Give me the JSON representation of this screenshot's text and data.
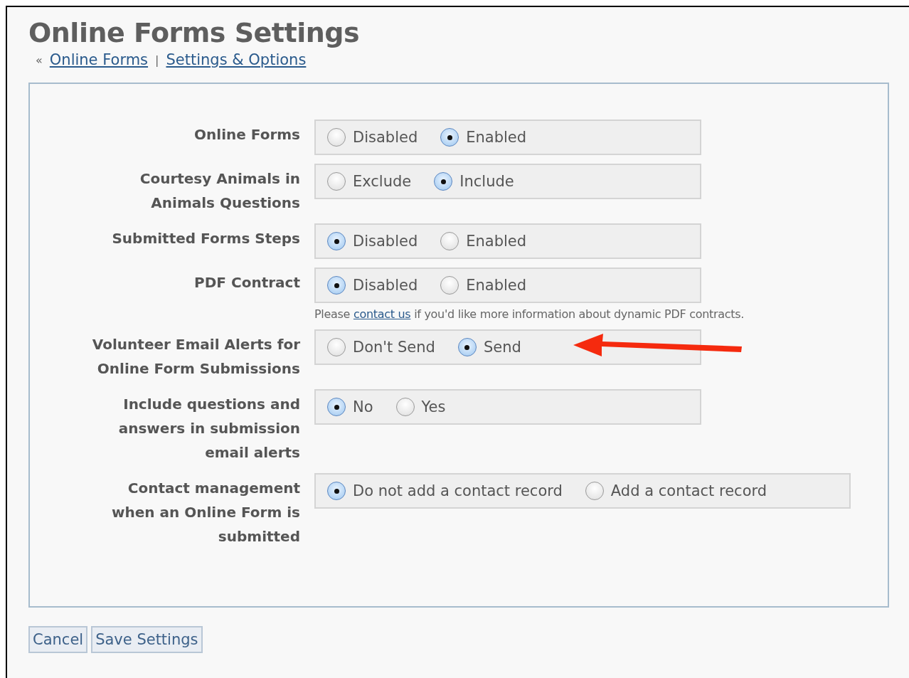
{
  "title": "Online Forms Settings",
  "breadcrumb": {
    "separator_prefix": "«",
    "links": [
      {
        "label": "Online Forms"
      },
      {
        "label": "Settings & Options"
      }
    ],
    "divider": "|"
  },
  "settings": [
    {
      "label": "Online Forms",
      "wide": false,
      "pointer_arrow": false,
      "options": [
        {
          "label": "Disabled",
          "selected": false
        },
        {
          "label": "Enabled",
          "selected": true
        }
      ]
    },
    {
      "label": "Courtesy Animals in Animals Questions",
      "wide": false,
      "pointer_arrow": false,
      "options": [
        {
          "label": "Exclude",
          "selected": false
        },
        {
          "label": "Include",
          "selected": true
        }
      ]
    },
    {
      "label": "Submitted Forms Steps",
      "wide": false,
      "pointer_arrow": false,
      "options": [
        {
          "label": "Disabled",
          "selected": true
        },
        {
          "label": "Enabled",
          "selected": false
        }
      ]
    },
    {
      "label": "PDF Contract",
      "wide": false,
      "pointer_arrow": false,
      "options": [
        {
          "label": "Disabled",
          "selected": true
        },
        {
          "label": "Enabled",
          "selected": false
        }
      ],
      "note": {
        "before": "Please",
        "link": "contact us",
        "after": "if you'd like more information about dynamic PDF contracts."
      }
    },
    {
      "label": "Volunteer Email Alerts for Online Form Submissions",
      "wide": false,
      "pointer_arrow": true,
      "options": [
        {
          "label": "Don't Send",
          "selected": false
        },
        {
          "label": "Send",
          "selected": true
        }
      ]
    },
    {
      "label": "Include questions and answers in submission email alerts",
      "wide": false,
      "pointer_arrow": false,
      "options": [
        {
          "label": "No",
          "selected": true
        },
        {
          "label": "Yes",
          "selected": false
        }
      ]
    },
    {
      "label": "Contact management when an Online Form is submitted",
      "wide": true,
      "pointer_arrow": false,
      "options": [
        {
          "label": "Do not add a contact record",
          "selected": true
        },
        {
          "label": "Add a contact record",
          "selected": false
        }
      ]
    }
  ],
  "buttons": [
    {
      "label": "Cancel"
    },
    {
      "label": "Save Settings"
    }
  ]
}
